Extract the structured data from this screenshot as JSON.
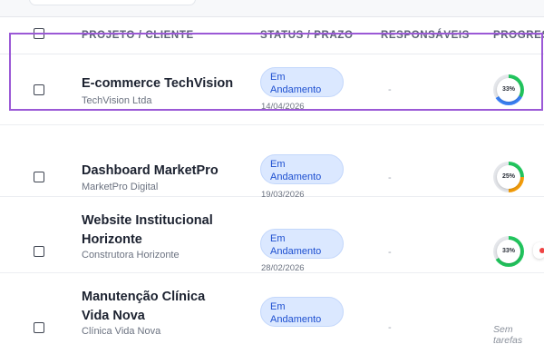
{
  "table": {
    "headers": {
      "project": "PROJETO / CLIENTE",
      "status": "STATUS / PRAZO",
      "responsibles": "RESPONSÁVEIS",
      "progress": "PROGRESS"
    },
    "rows": [
      {
        "title_lines": [
          "E-commerce TechVision"
        ],
        "client": "TechVision Ltda",
        "status_lines": [
          "Em",
          "Andamento"
        ],
        "deadline": "14/04/2026",
        "responsibles": "-",
        "progress": {
          "label": "33%",
          "value": 33,
          "color": "#3b82f6"
        }
      },
      {
        "title_lines": [
          "Dashboard MarketPro"
        ],
        "client": "MarketPro Digital",
        "status_lines": [
          "Em",
          "Andamento"
        ],
        "deadline": "19/03/2026",
        "responsibles": "-",
        "progress": {
          "label": "25%",
          "value": 25,
          "color": "#f59e0b"
        }
      },
      {
        "title_lines": [
          "Website Institucional",
          "Horizonte"
        ],
        "client": "Construtora Horizonte",
        "status_lines": [
          "Em",
          "Andamento"
        ],
        "deadline": "28/02/2026",
        "responsibles": "-",
        "progress": {
          "label": "33%",
          "value": 33,
          "color": "#22c55e"
        }
      },
      {
        "title_lines": [
          "Manutenção Clínica",
          "Vida Nova"
        ],
        "client": "Clínica Vida Nova",
        "status_lines": [
          "Em",
          "Andamento"
        ],
        "deadline": "",
        "responsibles": "-",
        "progress": {
          "label": "Sem tarefas"
        }
      }
    ]
  },
  "colors": {
    "status_pill_bg": "#dbe8ff",
    "status_pill_text": "#1d4fd0",
    "ring_track": "#e5e7eb",
    "ring_success": "#22c55e",
    "selection": "#9b59d6"
  }
}
